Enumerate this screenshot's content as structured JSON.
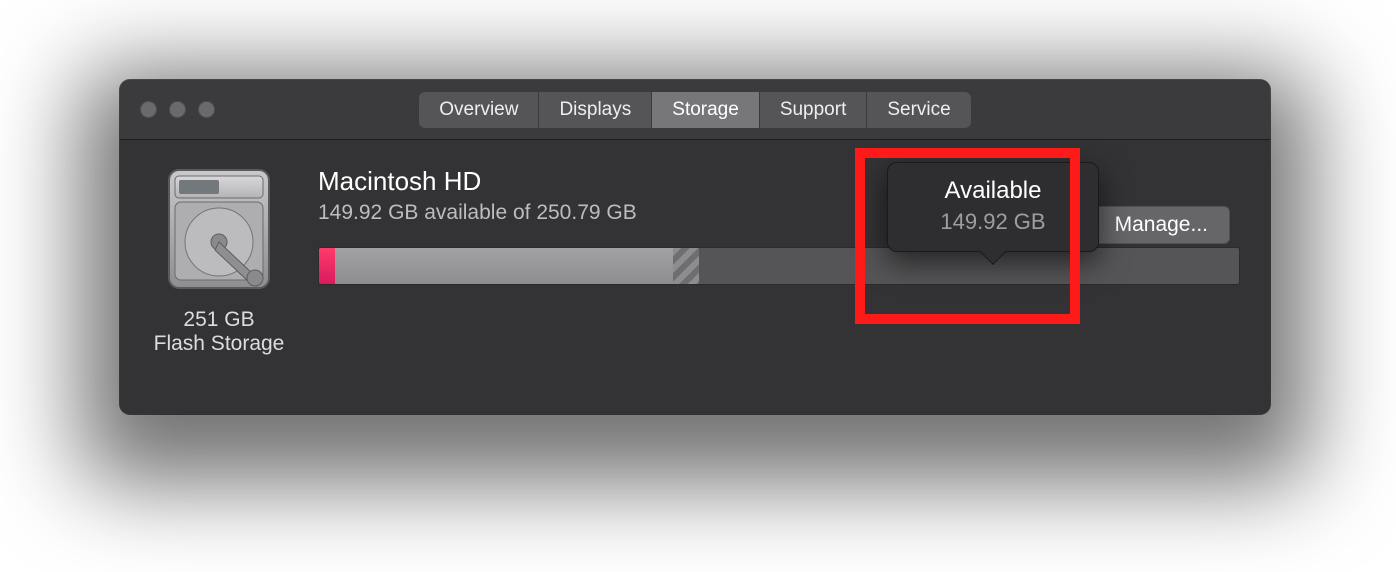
{
  "tabs": {
    "overview": "Overview",
    "displays": "Displays",
    "storage": "Storage",
    "support": "Support",
    "service": "Service"
  },
  "drive": {
    "size_line": "251 GB",
    "type_line": "Flash Storage"
  },
  "volume": {
    "name": "Macintosh HD",
    "summary": "149.92 GB available of 250.79 GB"
  },
  "popover": {
    "title": "Available",
    "value": "149.92 GB"
  },
  "manage_label": "Manage..."
}
